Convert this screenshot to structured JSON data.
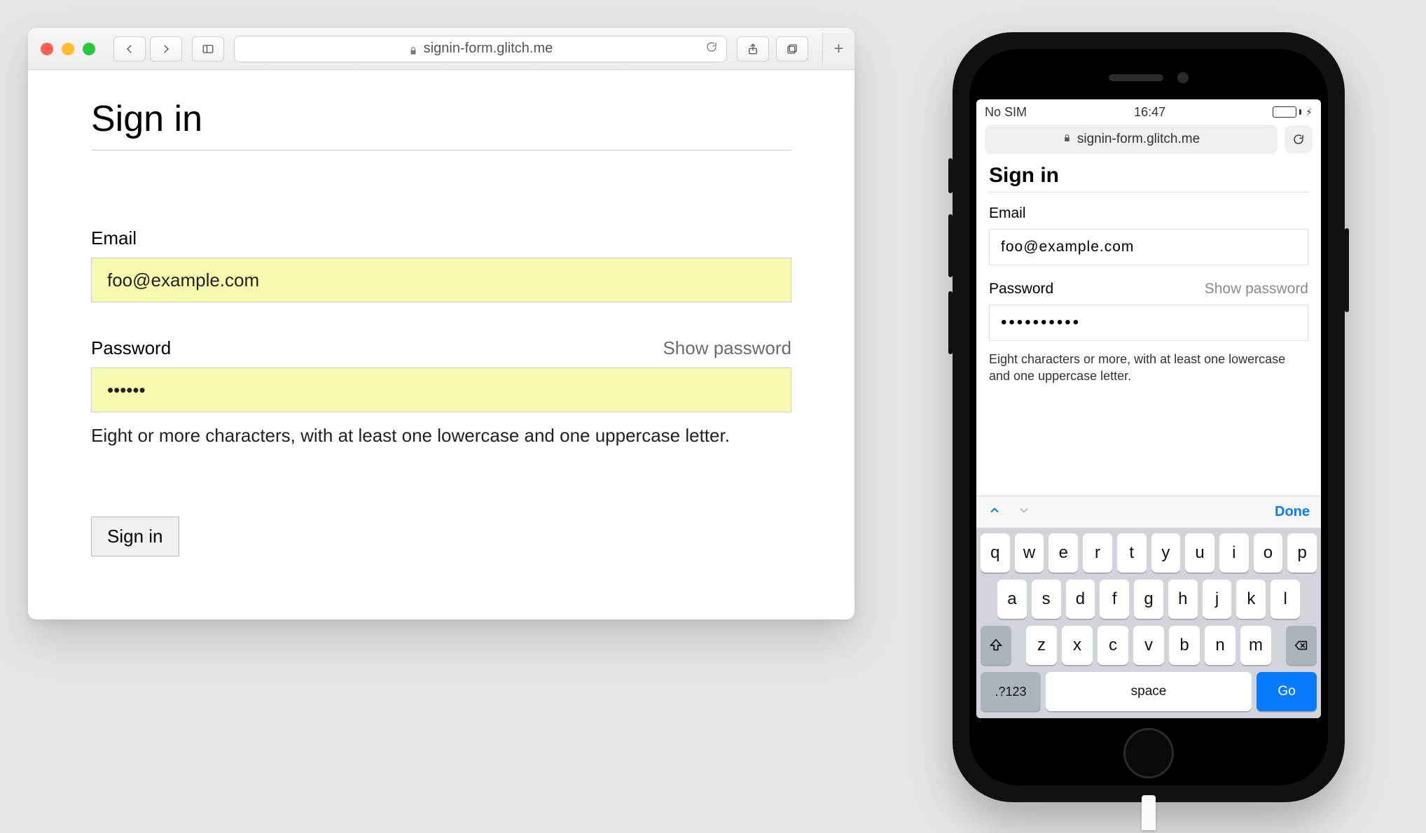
{
  "desktop": {
    "url_host": "signin-form.glitch.me",
    "page": {
      "title": "Sign in",
      "email_label": "Email",
      "email_value": "foo@example.com",
      "password_label": "Password",
      "show_password": "Show password",
      "password_value": "••••••",
      "hint": "Eight or more characters, with at least one lowercase and one uppercase letter.",
      "submit_label": "Sign in"
    }
  },
  "mobile": {
    "status": {
      "carrier": "No SIM",
      "time": "16:47"
    },
    "url_host": "signin-form.glitch.me",
    "page": {
      "title": "Sign in",
      "email_label": "Email",
      "email_value": "foo@example.com",
      "password_label": "Password",
      "show_password": "Show password",
      "password_value": "••••••••••",
      "hint": "Eight characters or more, with at least one lowercase and one uppercase letter."
    },
    "keyboard": {
      "done": "Done",
      "row1": [
        "q",
        "w",
        "e",
        "r",
        "t",
        "y",
        "u",
        "i",
        "o",
        "p"
      ],
      "row2": [
        "a",
        "s",
        "d",
        "f",
        "g",
        "h",
        "j",
        "k",
        "l"
      ],
      "row3": [
        "z",
        "x",
        "c",
        "v",
        "b",
        "n",
        "m"
      ],
      "numKey": ".?123",
      "space": "space",
      "go": "Go"
    }
  }
}
